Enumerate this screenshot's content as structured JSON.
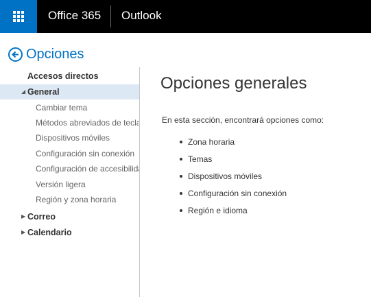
{
  "topbar": {
    "brand": "Office 365",
    "app": "Outlook"
  },
  "header": {
    "back_label": "Opciones"
  },
  "sidebar": {
    "shortcuts": "Accesos directos",
    "general": "General",
    "general_items": [
      "Cambiar tema",
      "Métodos abreviados de tecla",
      "Dispositivos móviles",
      "Configuración sin conexión",
      "Configuración de accesibilidad",
      "Versión ligera",
      "Región y zona horaria"
    ],
    "correo": "Correo",
    "calendario": "Calendario"
  },
  "main": {
    "title": "Opciones generales",
    "intro": "En esta sección, encontrará opciones como:",
    "bullets": [
      "Zona horaria",
      "Temas",
      "Dispositivos móviles",
      "Configuración sin conexión",
      "Región e idioma"
    ]
  },
  "colors": {
    "accent": "#0072c6",
    "topbar": "#000000",
    "selected": "#dce9f5"
  }
}
